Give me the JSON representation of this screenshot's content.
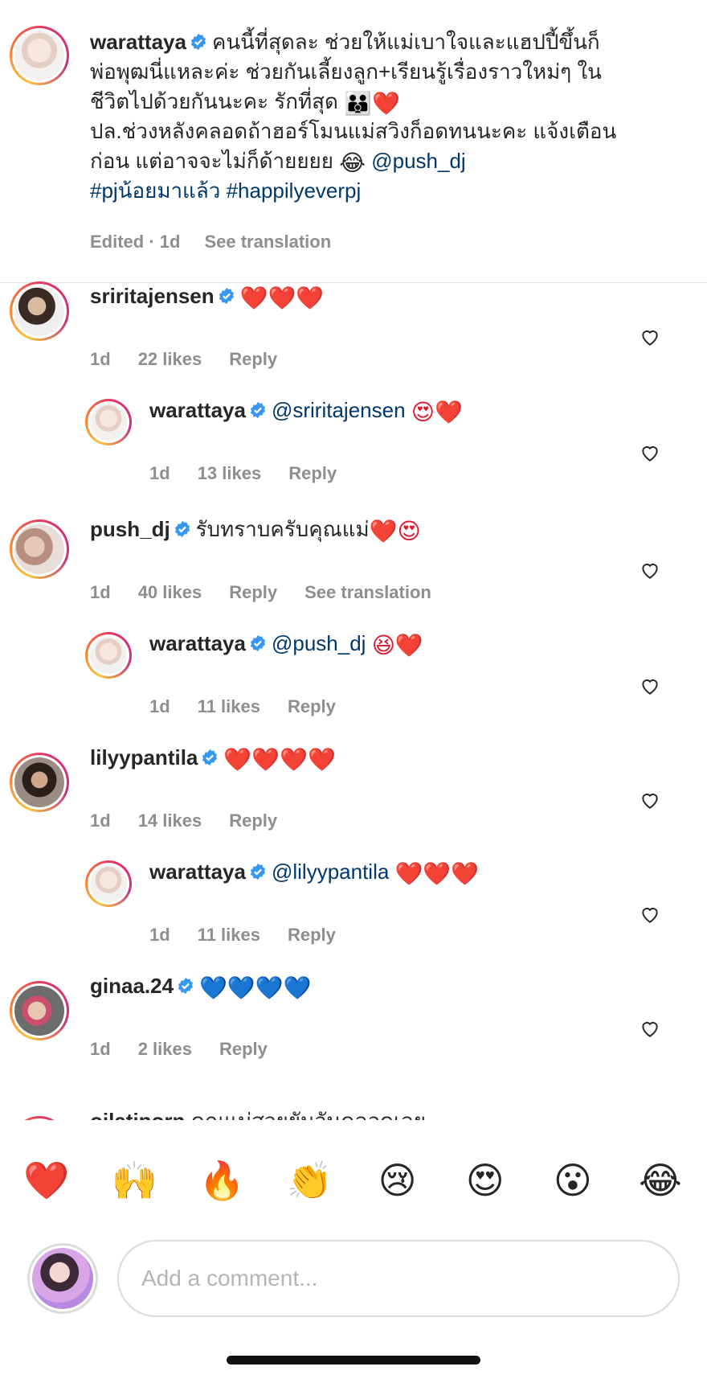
{
  "caption": {
    "username": "warattaya",
    "line1": "คนนี้ที่สุดละ ช่วยให้แม่เบาใจและแฮปปี้ขึ้นก็",
    "line2": "พ่อพุฒนี่แหละค่ะ ช่วยกันเลี้ยงลูก+เรียนรู้เรื่องราวใหม่ๆ ใน",
    "line3": "ชีวิตไปด้วยกันนะคะ รักที่สุด",
    "line3_emoji": "👪❤️",
    "line4": "ปล.ช่วงหลังคลอดถ้าฮอร์โมนแม่สวิงก็อดทนนะคะ แจ้งเตือน",
    "line5": "ก่อน แต่อาจจะไม่ก็ด้ายยยย",
    "line5_emoji": "😂",
    "mention": "@push_dj",
    "hashtag1": "#pjน้อยมาแล้ว",
    "hashtag2": "#happilyeverpj",
    "edited": "Edited · 1d",
    "see_translation": "See translation"
  },
  "comments": [
    {
      "username": "sriritajensen",
      "mention": "",
      "text": "",
      "emoji": "❤️❤️❤️",
      "emoji_color": "red",
      "age": "1d",
      "likes": "22 likes",
      "reply": "Reply",
      "translation": ""
    },
    {
      "username": "warattaya",
      "mention": "@sriritajensen",
      "text": "",
      "emoji": "😍❤️",
      "emoji_color": "red",
      "age": "1d",
      "likes": "13 likes",
      "reply": "Reply",
      "translation": ""
    },
    {
      "username": "push_dj",
      "mention": "",
      "text": "รับทราบครับคุณแม่",
      "emoji": "❤️😍",
      "emoji_color": "red",
      "age": "1d",
      "likes": "40 likes",
      "reply": "Reply",
      "translation": "See translation"
    },
    {
      "username": "warattaya",
      "mention": "@push_dj",
      "text": "",
      "emoji": "😆❤️",
      "emoji_color": "red",
      "age": "1d",
      "likes": "11 likes",
      "reply": "Reply",
      "translation": ""
    },
    {
      "username": "lilyypantila",
      "mention": "",
      "text": "",
      "emoji": "❤️❤️❤️❤️",
      "emoji_color": "red",
      "age": "1d",
      "likes": "14 likes",
      "reply": "Reply",
      "translation": ""
    },
    {
      "username": "warattaya",
      "mention": "@lilyypantila",
      "text": "",
      "emoji": "❤️❤️❤️",
      "emoji_color": "red",
      "age": "1d",
      "likes": "11 likes",
      "reply": "Reply",
      "translation": ""
    },
    {
      "username": "ginaa.24",
      "mention": "",
      "text": "",
      "emoji": "💙💙💙💙",
      "emoji_color": "blue",
      "age": "1d",
      "likes": "2 likes",
      "reply": "Reply",
      "translation": ""
    },
    {
      "username": "oilatiporn",
      "mention": "",
      "text": "คุณแม่สวยยันวันคลอดเลย",
      "emoji": "",
      "emoji_color": "red",
      "age": "",
      "likes": "",
      "reply": "",
      "translation": ""
    }
  ],
  "emoji_bar": [
    "❤️",
    "🙌",
    "🔥",
    "👏",
    "😢",
    "😍",
    "😮",
    "😂"
  ],
  "input": {
    "placeholder": "Add a comment..."
  },
  "colors": {
    "mention": "#00376b",
    "meta": "#8e8e8e",
    "verified": "#3897f0",
    "heart_red": "#e0152b"
  },
  "icons": {
    "verified": "verified-badge-icon",
    "like": "heart-outline-icon"
  }
}
